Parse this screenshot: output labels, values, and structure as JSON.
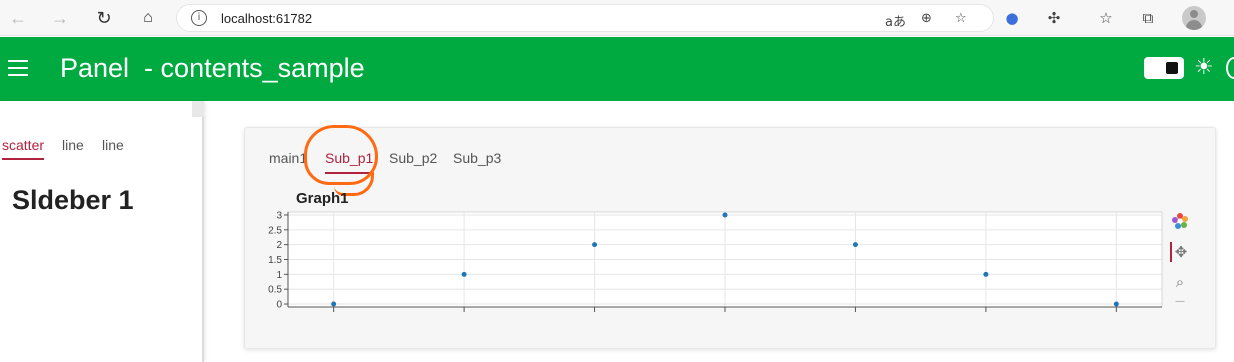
{
  "browser": {
    "url": "localhost:61782",
    "info_icon": "i",
    "read_aloud_icon": "aあ"
  },
  "header": {
    "title": "Panel  - contents_sample",
    "theme_toggle": "dark-mode-toggle"
  },
  "sidebar": {
    "tabs": [
      {
        "label": "scatter",
        "active": true
      },
      {
        "label": "line",
        "active": false
      },
      {
        "label": "line",
        "active": false
      }
    ],
    "title": "Sldeber 1"
  },
  "main": {
    "tabs": [
      {
        "label": "main1",
        "active": false
      },
      {
        "label": "Sub_p1",
        "active": true
      },
      {
        "label": "Sub_p2",
        "active": false
      },
      {
        "label": "Sub_p3",
        "active": false
      }
    ],
    "graph_title": "Graph1"
  },
  "chart_data": {
    "type": "scatter",
    "title": "Graph1",
    "xlabel": "",
    "ylabel": "",
    "x": [
      0,
      1,
      2,
      3,
      4,
      5,
      6
    ],
    "y": [
      0,
      1,
      2,
      3,
      2,
      1,
      0
    ],
    "xticks": [
      "0",
      "1",
      "2",
      "3",
      "4",
      "5",
      "6"
    ],
    "yticks": [
      "0",
      "0.5",
      "1",
      "1.5",
      "2",
      "2.5",
      "3"
    ],
    "xlim": [
      -0.35,
      6.35
    ],
    "ylim": [
      -0.1,
      3.1
    ],
    "grid": true,
    "point_color": "#1f77b4"
  },
  "colors": {
    "header": "#00aa41",
    "active_tab": "#b0233f",
    "annotation": "#ff6a13"
  }
}
